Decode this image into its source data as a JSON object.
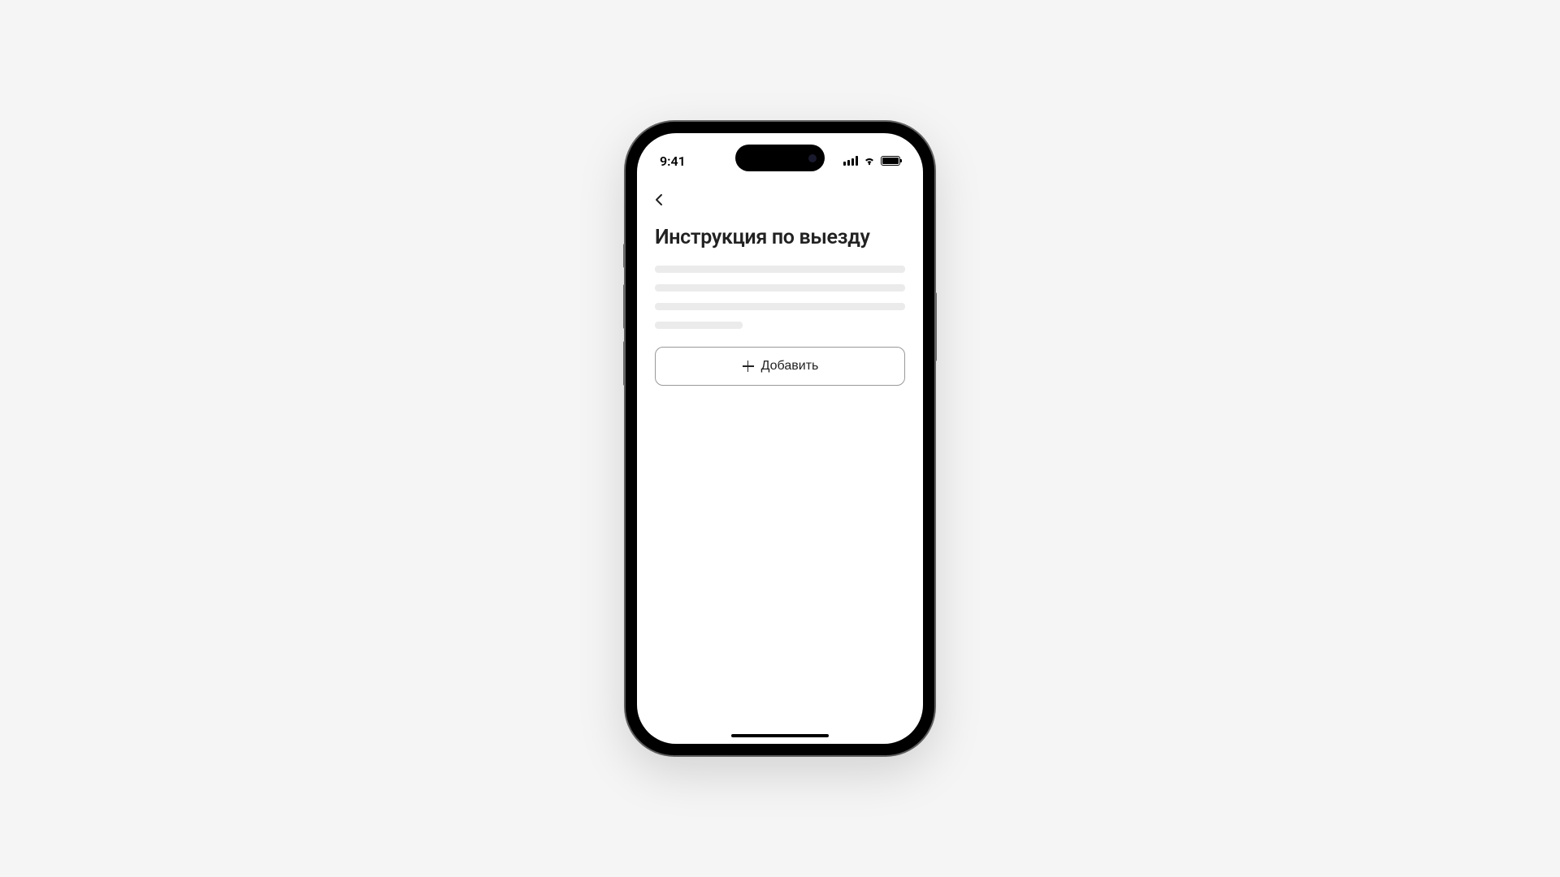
{
  "status_bar": {
    "time": "9:41"
  },
  "page": {
    "title": "Инструкция по выезду",
    "add_button_label": "Добавить"
  }
}
